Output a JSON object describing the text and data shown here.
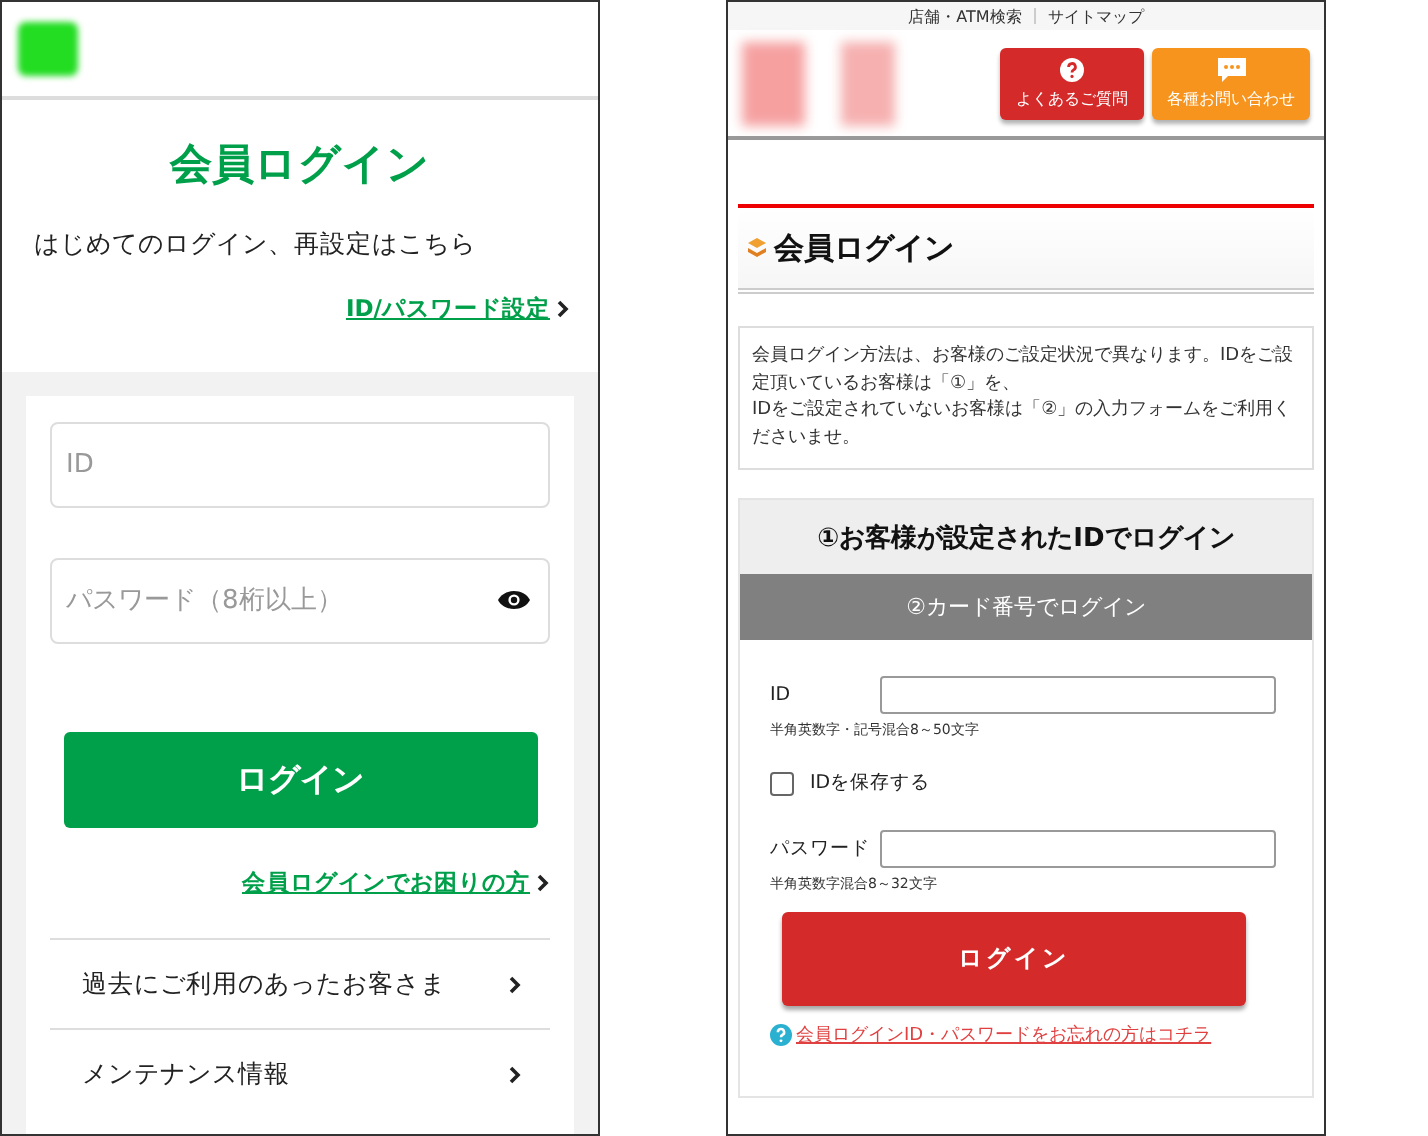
{
  "left_screen": {
    "title": "会員ログイン",
    "intro": "はじめてのログイン、再設定はこちら",
    "setup_link": "ID/パスワード設定",
    "id_field": {
      "placeholder": "ID"
    },
    "password_field": {
      "placeholder": "パスワード（8桁以上）"
    },
    "login_button": "ログイン",
    "help_link": "会員ログインでお困りの方",
    "menu_items": [
      {
        "label": "過去にご利用のあったお客さま"
      },
      {
        "label": "メンテナンス情報"
      }
    ]
  },
  "right_screen": {
    "top_links": [
      "店舗・ATM検索",
      "サイトマップ"
    ],
    "header_buttons": [
      {
        "kind": "faq",
        "label": "よくあるご質問",
        "color": "#d42a2a"
      },
      {
        "kind": "contact",
        "label": "各種お問い合わせ",
        "color": "#f7941d"
      }
    ],
    "title": "会員ログイン",
    "notice": "会員ログイン方法は、お客様のご設定状況で異なります。IDをご設定頂いているお客様は「①」を、\nIDをご設定されていないお客様は「②」の入力フォームをご利用くださいませ。",
    "tabs": [
      {
        "label": "①お客様が設定されたIDでログイン",
        "selected": true
      },
      {
        "label": "②カード番号でログイン",
        "selected": false
      }
    ],
    "id_label": "ID",
    "id_hint": "半角英数字・記号混合8～50文字",
    "save_id": {
      "label": "IDを保存する",
      "checked": false
    },
    "password_label": "パスワード",
    "password_hint": "半角英数字混合8～32文字",
    "login_button": "ログイン",
    "forgot_link": "会員ログインID・パスワードをお忘れの方はコチラ"
  }
}
